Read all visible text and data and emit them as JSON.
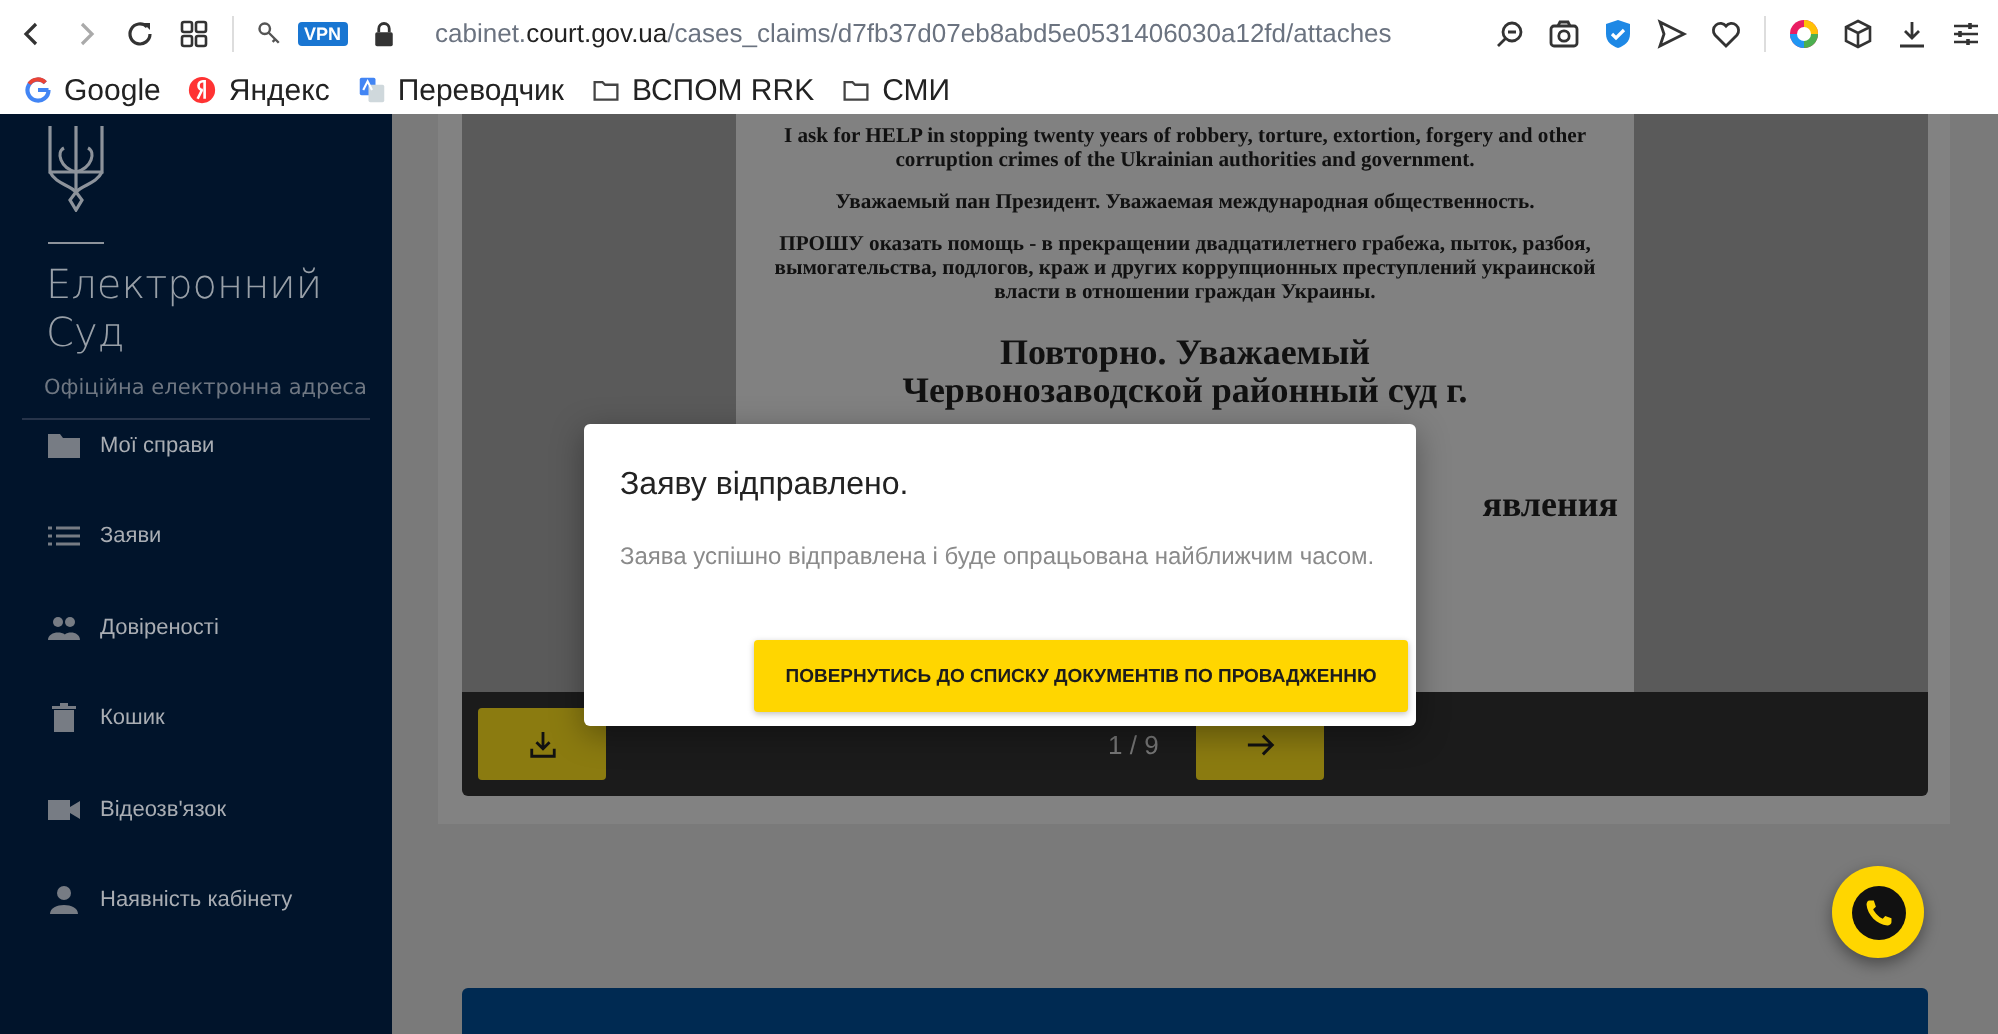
{
  "browser": {
    "vpn_badge": "VPN",
    "url": {
      "prefix": "cabinet.",
      "host": "court.gov.ua",
      "path": "/cases_claims/d7fb37d07eb8abd5e0531406030a12fd/attaches"
    },
    "bookmarks": [
      {
        "label": "Google",
        "kind": "google"
      },
      {
        "label": "Яндекс",
        "kind": "yandex"
      },
      {
        "label": "Переводчик",
        "kind": "translate"
      },
      {
        "label": "ВСПОМ RRK",
        "kind": "folder"
      },
      {
        "label": "СМИ",
        "kind": "folder"
      }
    ]
  },
  "sidebar": {
    "title": "Електронний Суд",
    "subtitle": "Офіційна електронна адреса",
    "items": [
      {
        "label": "Мої справи",
        "kind": "folder"
      },
      {
        "label": "Заяви",
        "kind": "list"
      },
      {
        "label": "Довіреності",
        "kind": "people"
      },
      {
        "label": "Кошик",
        "kind": "trash"
      },
      {
        "label": "Відеозв'язок",
        "kind": "video"
      },
      {
        "label": "Наявність кабінету",
        "kind": "person"
      }
    ]
  },
  "viewer": {
    "document": {
      "paragraphs": [
        "I ask for HELP in stopping twenty years of robbery, torture, extortion, forgery and other corruption crimes of the Ukrainian authorities and government.",
        "Уважаемый пан Президент. Уважаемая международная общественность.",
        "ПРОШУ оказать помощь - в прекращении двадцатилетнего грабежа, пыток, разбоя, вымогательства, подлогов, краж и других коррупционных преступлений украинской власти в отношении граждан Украины."
      ],
      "heading": [
        "Повторно. Уважаемый",
        "Червонозаводской районный суд г."
      ],
      "heading_fragment": "явления"
    },
    "page_indicator": "1 / 9"
  },
  "modal": {
    "title": "Заяву відправлено.",
    "message": "Заява успішно відправлена і буде опрацьована найближчим часом.",
    "button": "ПОВЕРНУТИСЬ ДО СПИСКУ ДОКУМЕНТІВ ПО ПРОВАДЖЕННЮ"
  }
}
